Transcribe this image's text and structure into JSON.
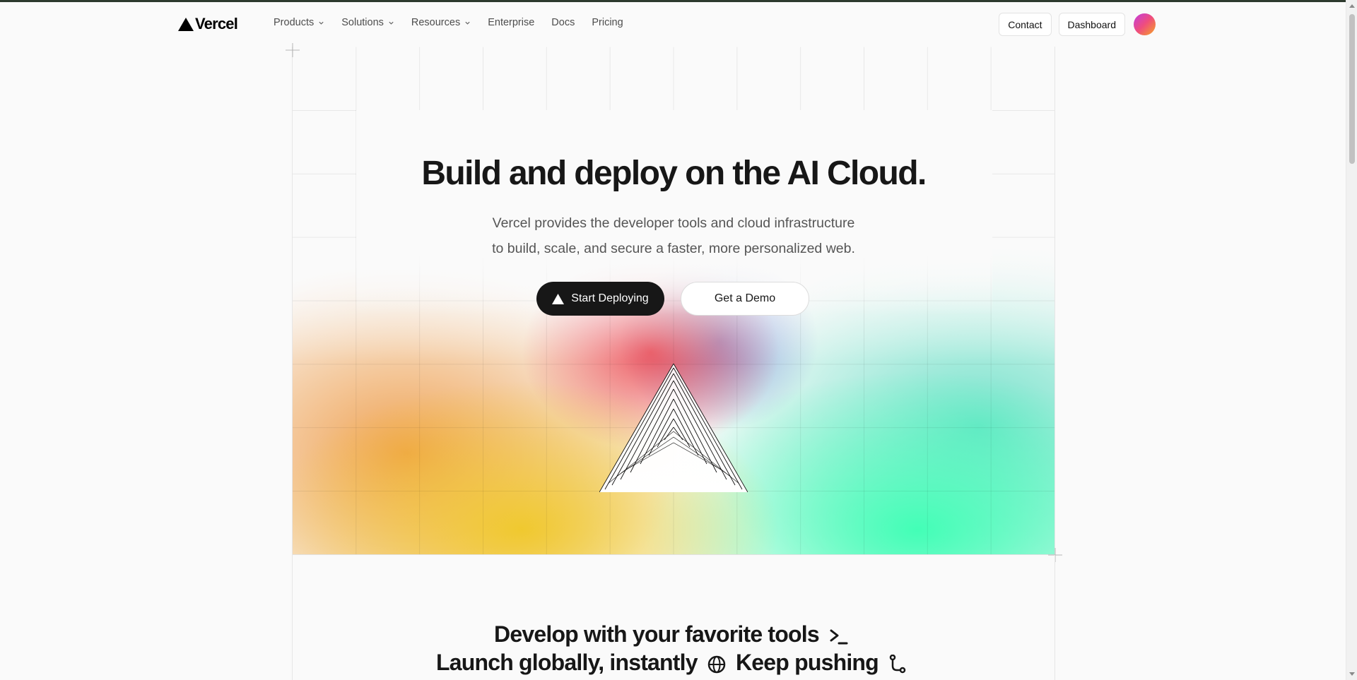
{
  "brand": {
    "name": "Vercel",
    "logo_icon": "triangle-logo-icon"
  },
  "nav": {
    "items": [
      {
        "label": "Products",
        "has_dropdown": true
      },
      {
        "label": "Solutions",
        "has_dropdown": true
      },
      {
        "label": "Resources",
        "has_dropdown": true
      },
      {
        "label": "Enterprise",
        "has_dropdown": false
      },
      {
        "label": "Docs",
        "has_dropdown": false
      },
      {
        "label": "Pricing",
        "has_dropdown": false
      }
    ],
    "contact_label": "Contact",
    "dashboard_label": "Dashboard"
  },
  "hero": {
    "title": "Build and deploy on the AI Cloud.",
    "subtitle_line1": "Vercel provides the developer tools and cloud infrastructure",
    "subtitle_line2": "to build, scale, and secure a faster, more personalized web.",
    "primary_cta": "Start Deploying",
    "secondary_cta": "Get a Demo"
  },
  "tagline": {
    "line1_text": "Develop with your favorite tools",
    "line1_icon": "terminal-prompt-icon",
    "line2_part1": "Launch globally, instantly",
    "line2_icon1": "globe-icon",
    "line2_part2": "Keep pushing",
    "line2_icon2": "git-branch-icon"
  },
  "colors": {
    "text_primary": "#171717",
    "text_secondary": "#555555",
    "gradient_yellow": "#f0c828",
    "gradient_orange": "#ee963c",
    "gradient_red": "#eb3c46",
    "gradient_blue": "#5a78d2",
    "gradient_green": "#3cffb4"
  }
}
